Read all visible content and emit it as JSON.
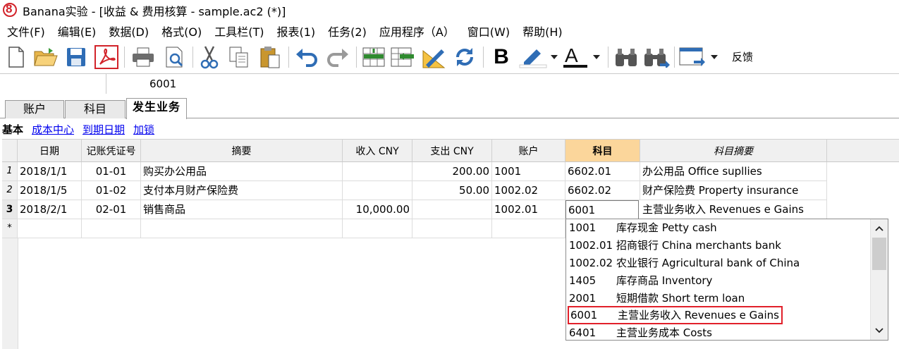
{
  "window": {
    "title": "Banana实验 - [收益 & 费用核算 - sample.ac2 (*)]"
  },
  "menu": [
    "文件(F)",
    "编辑(E)",
    "数据(D)",
    "格式(O)",
    "工具栏(T)",
    "报表(1)",
    "任务(2)",
    "应用程序（A）",
    "窗口(W)",
    "帮助(H)"
  ],
  "toolbar": {
    "icons": [
      "new-file-icon",
      "open-folder-icon",
      "save-icon",
      "pdf-icon",
      "print-icon",
      "print-preview-icon",
      "cut-icon",
      "copy-icon",
      "paste-icon",
      "undo-icon",
      "redo-icon",
      "insert-rows-icon",
      "delete-rows-icon",
      "edit-ruler-icon",
      "recalculate-icon",
      "bold-icon",
      "highlight-icon",
      "font-color-icon",
      "find-icon",
      "find-next-icon",
      "window-layout-icon"
    ],
    "feedback_label": "反馈"
  },
  "formula_bar": {
    "cell_ref": "",
    "value": "6001"
  },
  "tabs": [
    "账户",
    "科目",
    "发生业务"
  ],
  "active_tab": "发生业务",
  "views": {
    "current": "基本",
    "links": [
      "成本中心",
      "到期日期",
      "加锁"
    ]
  },
  "table": {
    "headers": [
      "日期",
      "记账凭证号",
      "摘要",
      "收入 CNY",
      "支出 CNY",
      "账户",
      "科目",
      "科目摘要"
    ],
    "rows": [
      {
        "num": "1",
        "date": "2018/1/1",
        "voucher": "01-01",
        "desc": "购买办公用品",
        "income": "",
        "expense": "200.00",
        "account": "1001",
        "category": "6602.01",
        "category_desc": "办公用品 Office supllies"
      },
      {
        "num": "2",
        "date": "2018/1/5",
        "voucher": "01-02",
        "desc": "支付本月财产保险费",
        "income": "",
        "expense": "50.00",
        "account": "1002.02",
        "category": "6602.02",
        "category_desc": "财产保险费 Property insurance"
      },
      {
        "num": "3",
        "date": "2018/2/1",
        "voucher": "02-01",
        "desc": "销售商品",
        "income": "10,000.00",
        "expense": "",
        "account": "1002.01",
        "category": "6001",
        "category_desc": "主营业务收入 Revenues e Gains"
      }
    ],
    "new_row_marker": "*"
  },
  "dropdown": {
    "items": [
      {
        "code": "1001",
        "name": "库存现金 Petty cash"
      },
      {
        "code": "1002.01",
        "name": "招商银行 China merchants bank"
      },
      {
        "code": "1002.02",
        "name": "农业银行 Agricultural bank of China"
      },
      {
        "code": "1405",
        "name": "库存商品 Inventory"
      },
      {
        "code": "2001",
        "name": "短期借款 Short term loan"
      },
      {
        "code": "6001",
        "name": "主营业务收入 Revenues e Gains"
      },
      {
        "code": "6401",
        "name": "主营业务成本 Costs"
      }
    ],
    "selected_code": "6001"
  },
  "colors": {
    "selected_column_header": "#fbd69b",
    "selection_border": "#e1202a",
    "link": "#0000ee",
    "logo": "#d2232a"
  }
}
